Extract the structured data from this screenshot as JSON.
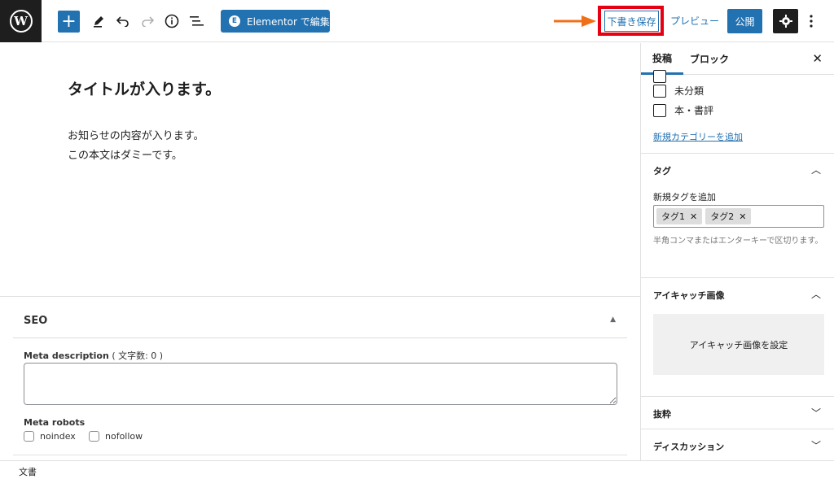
{
  "toolbar": {
    "logo_icon": "wordpress-logo-icon",
    "logo_glyph": "W",
    "add_block": "+",
    "elementor_label": "Elementor で編集",
    "elementor_icon_glyph": "E",
    "save_draft_label": "下書き保存",
    "preview_label": "プレビュー",
    "publish_label": "公開",
    "highlight_color": "#e60012",
    "arrow_color": "#f07018",
    "accent_color": "#2271b1"
  },
  "editor": {
    "title": "タイトルが入ります。",
    "body_lines": [
      "お知らせの内容が入ります。",
      "この本文はダミーです。"
    ]
  },
  "seo": {
    "title": "SEO",
    "meta_description_label": "Meta description",
    "char_count_text": "( 文字数: 0 )",
    "meta_description_value": "",
    "meta_robots_label": "Meta robots",
    "noindex_label": "noindex",
    "nofollow_label": "nofollow"
  },
  "footer": {
    "breadcrumb": "文書"
  },
  "sidebar": {
    "tab_post": "投稿",
    "tab_block": "ブロック",
    "categories": [
      "未分類",
      "本・書評"
    ],
    "add_category_link": "新規カテゴリーを追加",
    "tags_title": "タグ",
    "add_tag_label": "新規タグを追加",
    "tags": [
      "タグ1",
      "タグ2"
    ],
    "tag_help": "半角コンマまたはエンターキーで区切ります。",
    "featured_title": "アイキャッチ画像",
    "featured_button": "アイキャッチ画像を設定",
    "excerpt_title": "抜粋",
    "discussion_title": "ディスカッション"
  }
}
